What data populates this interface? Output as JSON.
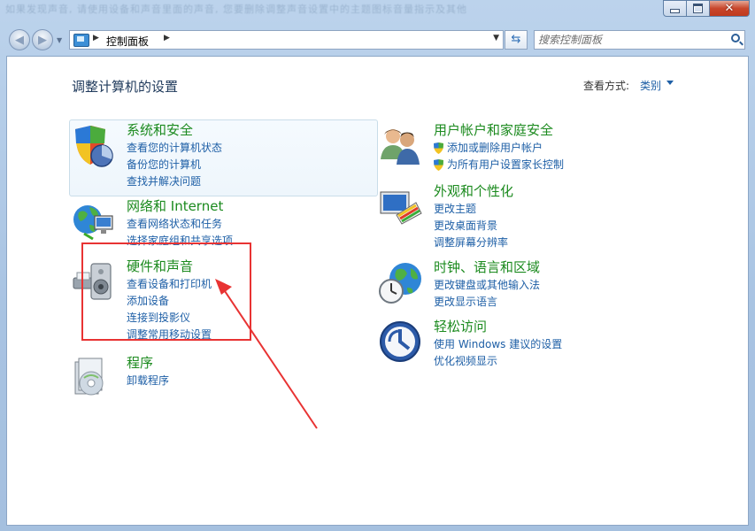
{
  "window": {
    "title_blurred": "如果发现声音, 请使用设备和声音里面的声音, 您要删除调整声音设置中的主题图标音量指示及其他",
    "buttons": {
      "minimize": "minimize",
      "maximize": "maximize",
      "close": "close"
    }
  },
  "nav": {
    "breadcrumb": "控制面板",
    "search_placeholder": "搜索控制面板"
  },
  "main": {
    "title": "调整计算机的设置",
    "view_by_label": "查看方式:",
    "view_by_value": "类别"
  },
  "categories": [
    {
      "id": "system-security",
      "title": "系统和安全",
      "icon": "shield-pie-icon",
      "links": [
        "查看您的计算机状态",
        "备份您的计算机",
        "查找并解决问题"
      ]
    },
    {
      "id": "network-internet",
      "title": "网络和 Internet",
      "icon": "network-globe-icon",
      "links": [
        "查看网络状态和任务",
        "选择家庭组和共享选项"
      ]
    },
    {
      "id": "hardware-sound",
      "title": "硬件和声音",
      "icon": "printer-speaker-icon",
      "links": [
        "查看设备和打印机",
        "添加设备",
        "连接到投影仪",
        "调整常用移动设置"
      ]
    },
    {
      "id": "programs",
      "title": "程序",
      "icon": "programs-disc-icon",
      "links": [
        "卸载程序"
      ]
    },
    {
      "id": "user-accounts",
      "title": "用户帐户和家庭安全",
      "icon": "users-icon",
      "links": [
        "添加或删除用户帐户",
        "为所有用户设置家长控制"
      ]
    },
    {
      "id": "appearance",
      "title": "外观和个性化",
      "icon": "monitor-palette-icon",
      "links": [
        "更改主题",
        "更改桌面背景",
        "调整屏幕分辨率"
      ]
    },
    {
      "id": "clock-region",
      "title": "时钟、语言和区域",
      "icon": "globe-clock-icon",
      "links": [
        "更改键盘或其他输入法",
        "更改显示语言"
      ]
    },
    {
      "id": "ease-of-access",
      "title": "轻松访问",
      "icon": "ease-of-access-icon",
      "links": [
        "使用 Windows 建议的设置",
        "优化视频显示"
      ]
    }
  ],
  "colors": {
    "category_title": "#1b8a1e",
    "link": "#1e5fa6",
    "annotation_red": "#e83333"
  }
}
